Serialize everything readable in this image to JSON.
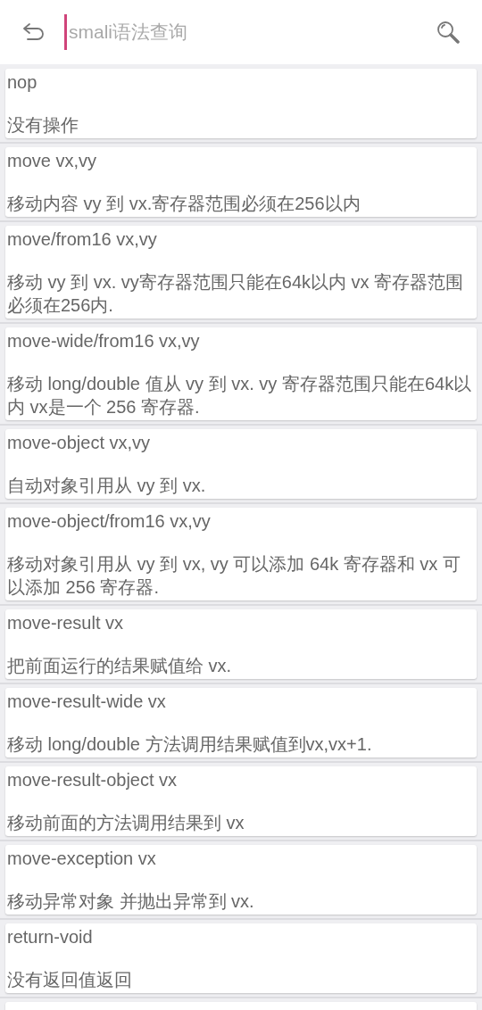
{
  "search": {
    "placeholder": "smali语法查询"
  },
  "items": [
    {
      "title": "nop",
      "description": "没有操作"
    },
    {
      "title": "move vx,vy",
      "description": "移动内容 vy 到 vx.寄存器范围必须在256以内"
    },
    {
      "title": "move/from16 vx,vy",
      "description": "移动 vy 到 vx. vy寄存器范围只能在64k以内 vx 寄存器范围必须在256内."
    },
    {
      "title": "move-wide/from16 vx,vy",
      "description": "移动 long/double 值从 vy 到 vx. vy 寄存器范围只能在64k以内 vx是一个 256 寄存器."
    },
    {
      "title": "move-object vx,vy",
      "description": "自动对象引用从 vy 到 vx."
    },
    {
      "title": "move-object/from16 vx,vy",
      "description": "移动对象引用从 vy 到 vx, vy 可以添加 64k 寄存器和 vx 可以添加 256 寄存器."
    },
    {
      "title": "move-result vx",
      "description": "把前面运行的结果赋值给 vx."
    },
    {
      "title": "move-result-wide vx",
      "description": "移动 long/double 方法调用结果赋值到vx,vx+1."
    },
    {
      "title": "move-result-object vx",
      "description": "移动前面的方法调用结果到 vx"
    },
    {
      "title": "move-exception vx",
      "description": "移动异常对象 并抛出异常到 vx."
    },
    {
      "title": "return-void",
      "description": "没有返回值返回"
    }
  ]
}
